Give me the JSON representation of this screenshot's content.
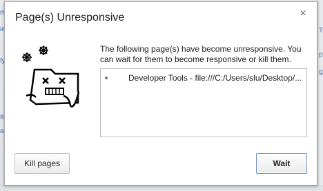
{
  "dialog": {
    "title": "Page(s) Unresponsive",
    "close_glyph": "×",
    "message": "The following page(s) have become unresponsive. You can wait for them to become responsive or kill them.",
    "pages": [
      {
        "label": "Developer Tools - file:///C:/Users/slu/Desktop/..."
      }
    ],
    "buttons": {
      "kill": "Kill pages",
      "wait": "Wait"
    }
  },
  "background": {
    "left_fragments": [
      "m",
      "ie",
      "fy",
      "a",
      "al"
    ],
    "right_fragments": [
      "T",
      "p",
      "g"
    ]
  },
  "colors": {
    "dialog_bg": "#ffffff",
    "text": "#202020",
    "default_button_border": "#6f90c7"
  },
  "icons": {
    "close": "close-icon",
    "illustration": "sad-folder-illustration"
  }
}
